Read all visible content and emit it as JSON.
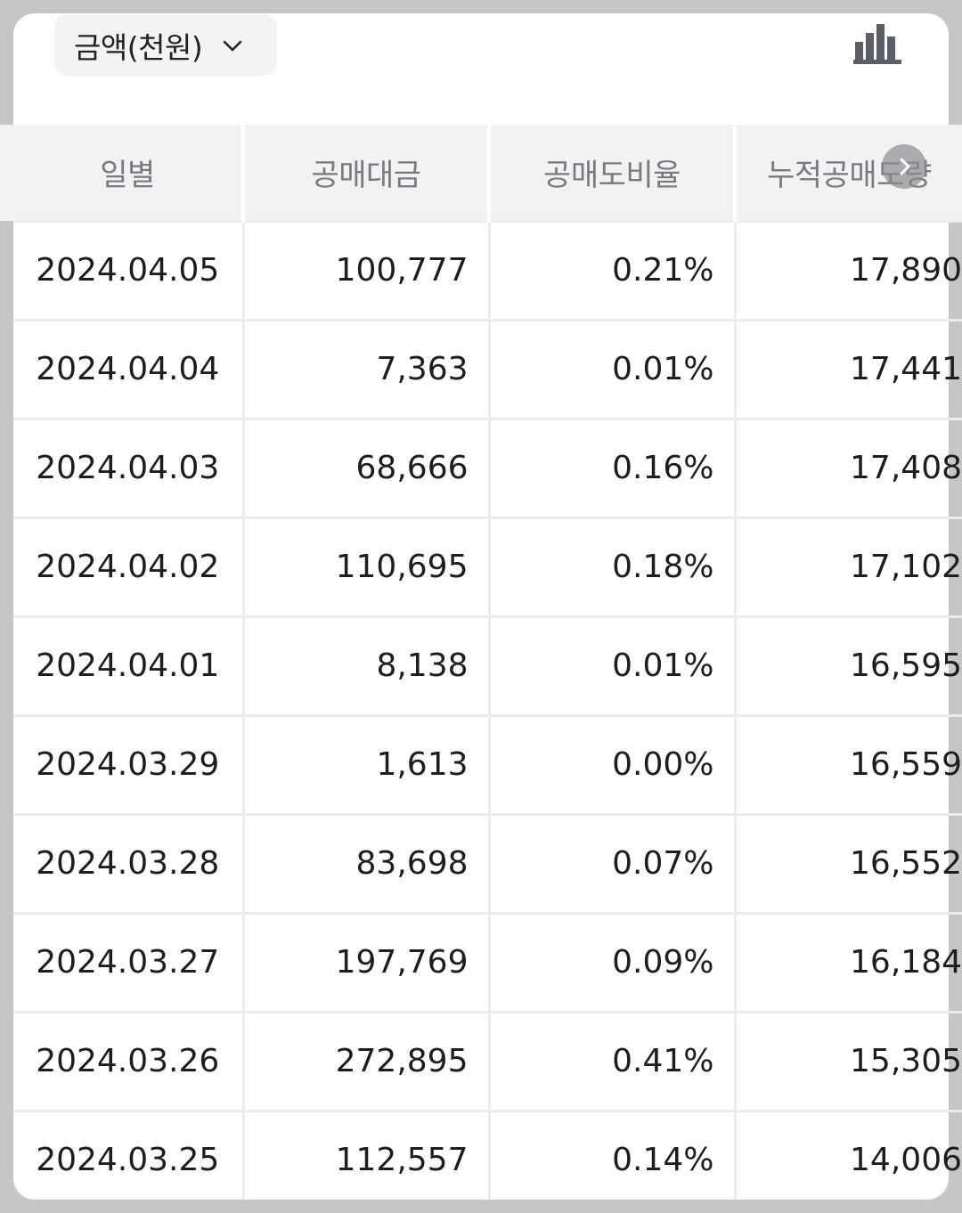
{
  "filter": {
    "label": "금액(천원)"
  },
  "table": {
    "headers": [
      "일별",
      "공매대금",
      "공매도비율",
      "누적공매도량"
    ],
    "rows": [
      [
        "2024.04.05",
        "100,777",
        "0.21%",
        "17,890"
      ],
      [
        "2024.04.04",
        "7,363",
        "0.01%",
        "17,441"
      ],
      [
        "2024.04.03",
        "68,666",
        "0.16%",
        "17,408"
      ],
      [
        "2024.04.02",
        "110,695",
        "0.18%",
        "17,102"
      ],
      [
        "2024.04.01",
        "8,138",
        "0.01%",
        "16,595"
      ],
      [
        "2024.03.29",
        "1,613",
        "0.00%",
        "16,559"
      ],
      [
        "2024.03.28",
        "83,698",
        "0.07%",
        "16,552"
      ],
      [
        "2024.03.27",
        "197,769",
        "0.09%",
        "16,184"
      ],
      [
        "2024.03.26",
        "272,895",
        "0.41%",
        "15,305"
      ],
      [
        "2024.03.25",
        "112,557",
        "0.14%",
        "14,006"
      ]
    ]
  },
  "colors": {
    "icon": "#5a5f69",
    "header_bg": "#f1f2f4",
    "header_text": "#777a80",
    "background": "#c6c6c8"
  },
  "icons": {
    "chart": "bar-chart-icon",
    "dropdown": "chevron-down-icon",
    "scroll": "chevron-right-icon"
  }
}
